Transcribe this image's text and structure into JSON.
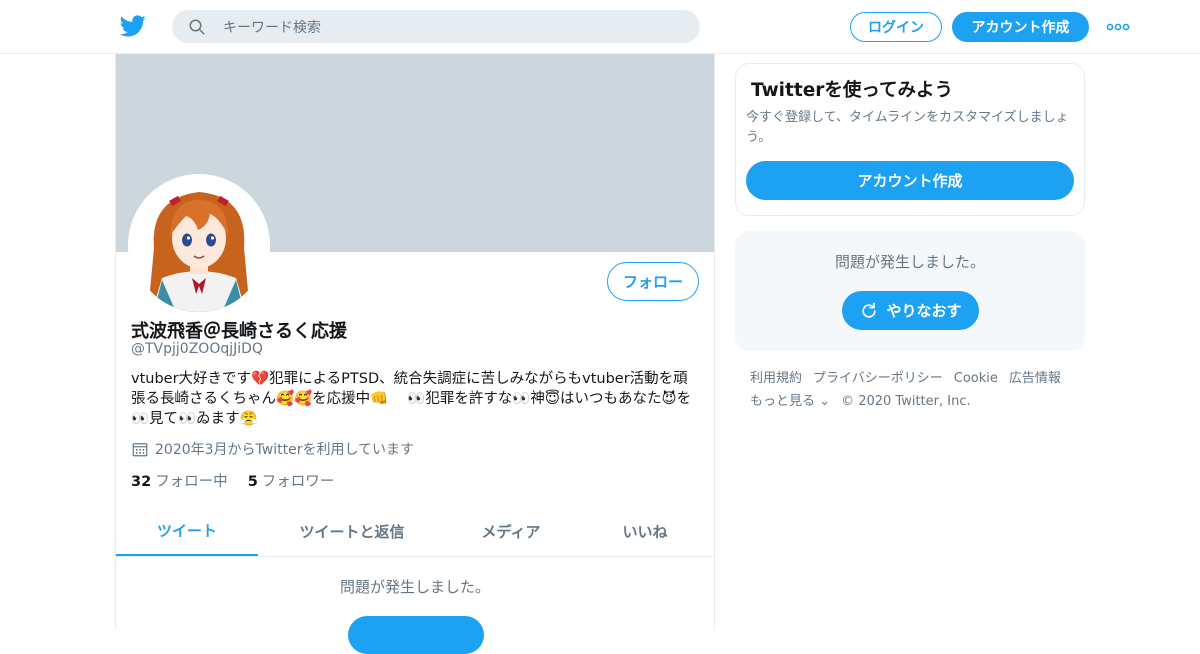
{
  "header": {
    "search_placeholder": "キーワード検索",
    "login_label": "ログイン",
    "signup_label": "アカウント作成"
  },
  "profile": {
    "display_name": "式波飛香＠長崎さるく応援",
    "handle": "@TVpjj0ZOOqjJiDQ",
    "bio": "vtuber大好きです💔犯罪によるPTSD、統合失調症に苦しみながらもvtuber活動を頑張る長崎さるくちゃん🥰🥰を応援中👊 　👀犯罪を許すな👀神😇はいつもあなた😈を👀見て👀ゐます😤",
    "joined": "2020年3月からTwitterを利用しています",
    "following_count": "32",
    "following_label": "フォロー中",
    "followers_count": "5",
    "followers_label": "フォロワー",
    "follow_label": "フォロー"
  },
  "tabs": [
    {
      "label": "ツイート",
      "active": true
    },
    {
      "label": "ツイートと返信",
      "active": false
    },
    {
      "label": "メディア",
      "active": false
    },
    {
      "label": "いいね",
      "active": false
    }
  ],
  "main_error": "問題が発生しました。",
  "sidebar": {
    "card_title": "Twitterを使ってみよう",
    "card_subtitle": "今すぐ登録して、タイムラインをカスタマイズしましょう。",
    "card_button": "アカウント作成",
    "error_text": "問題が発生しました。",
    "retry_label": "やりなおす"
  },
  "footer": {
    "links": [
      "利用規約",
      "プライバシーポリシー",
      "Cookie",
      "広告情報",
      "もっと見る"
    ],
    "copyright": "© 2020 Twitter, Inc."
  },
  "colors": {
    "accent": "#1da1f2",
    "banner": "#ccd6dd",
    "muted_text": "#657786"
  }
}
